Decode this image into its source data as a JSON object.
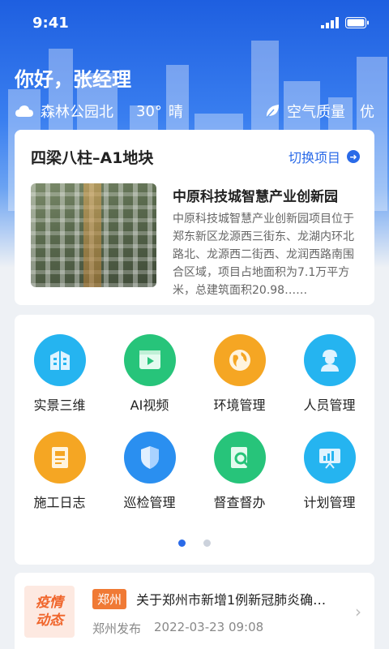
{
  "status": {
    "time": "9:41"
  },
  "header": {
    "greeting": "你好，张经理",
    "location": "森林公园北",
    "temperature": "30°",
    "weather": "晴",
    "air_label": "空气质量",
    "air_value": "优"
  },
  "project": {
    "name": "四梁八柱–A1地块",
    "switch_label": "切换项目",
    "title": "中原科技城智慧产业创新园",
    "description": "中原科技城智慧产业创新园项目位于郑东新区龙源西三街东、龙湖内环北路北、龙源西二街西、龙润西路南围合区域，项目占地面积为7.1万平方米，总建筑面积20.98……"
  },
  "menu": {
    "items": [
      {
        "label": "实景三维",
        "icon": "building-3d-icon",
        "color": "#25b4f0"
      },
      {
        "label": "AI视频",
        "icon": "video-play-icon",
        "color": "#27c47a"
      },
      {
        "label": "环境管理",
        "icon": "globe-icon",
        "color": "#f5a623"
      },
      {
        "label": "人员管理",
        "icon": "worker-icon",
        "color": "#25b4f0"
      },
      {
        "label": "施工日志",
        "icon": "document-icon",
        "color": "#f5a623"
      },
      {
        "label": "巡检管理",
        "icon": "shield-icon",
        "color": "#2a8ff0"
      },
      {
        "label": "督查督办",
        "icon": "search-doc-icon",
        "color": "#27c47a"
      },
      {
        "label": "计划管理",
        "icon": "chart-board-icon",
        "color": "#25b4f0"
      }
    ],
    "page": 1,
    "pages": 2
  },
  "news": {
    "badge_line1": "疫情",
    "badge_line2": "动态",
    "tag": "郑州",
    "title": "关于郑州市新增1例新冠肺炎确…",
    "source": "郑州发布",
    "datetime": "2022-03-23  09:08"
  },
  "colors": {
    "accent": "#2a6ae8",
    "news_tag": "#f07a35"
  }
}
